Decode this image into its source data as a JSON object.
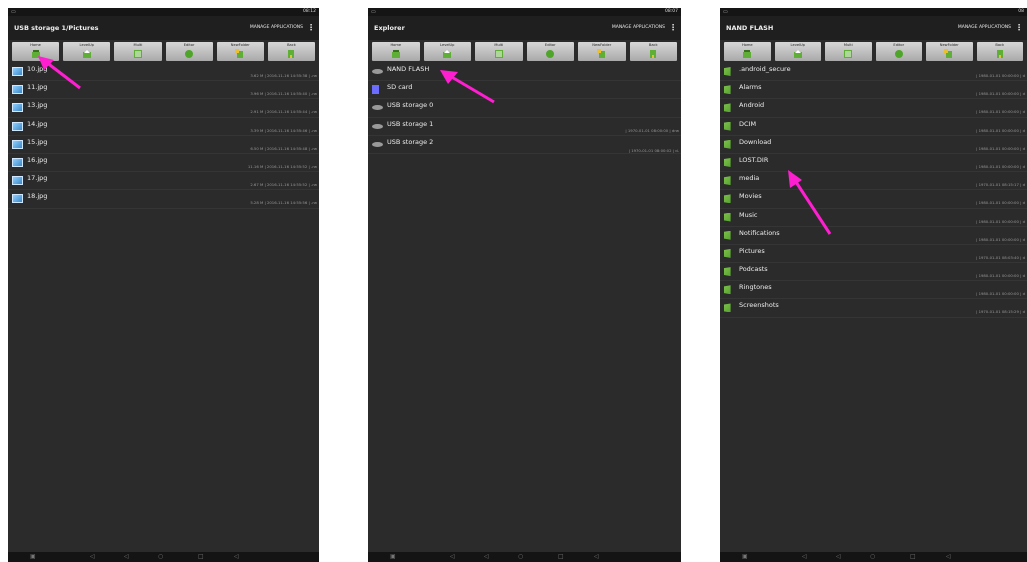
{
  "colors": {
    "accent_arrow": "#ff1fd0",
    "folder": "#5fae35",
    "background": "#2b2b2b"
  },
  "toolbar_labels": [
    "Home",
    "LevelUp",
    "Multi",
    "Editor",
    "NewFolder",
    "Back"
  ],
  "screen1": {
    "status_time": "08:12",
    "title": "USB storage 1/Pictures",
    "manage": "MANAGE APPLICATIONS",
    "overflow": "⋮",
    "files": [
      {
        "name": "10.jpg",
        "meta": "3.62 M | 2016-11-16 14:55:38 | -rw"
      },
      {
        "name": "11.jpg",
        "meta": "3.96 M | 2016-11-16 14:55:40 | -rw"
      },
      {
        "name": "13.jpg",
        "meta": "2.91 M | 2016-11-16 14:55:44 | -rw"
      },
      {
        "name": "14.jpg",
        "meta": "3.39 M | 2016-11-16 14:55:46 | -rw"
      },
      {
        "name": "15.jpg",
        "meta": "6.50 M | 2016-11-16 14:55:48 | -rw"
      },
      {
        "name": "16.jpg",
        "meta": "11.16 M | 2016-11-16 14:55:52 | -rw"
      },
      {
        "name": "17.jpg",
        "meta": "2.67 M | 2016-11-16 14:55:52 | -rw"
      },
      {
        "name": "18.jpg",
        "meta": "5.28 M | 2016-11-16 14:55:56 | -rw"
      }
    ]
  },
  "screen2": {
    "status_time": "08:07",
    "title": "Explorer",
    "manage": "MANAGE APPLICATIONS",
    "overflow": "⋮",
    "items": [
      {
        "name": "NAND FLASH",
        "meta": "",
        "icon": "drive-icon"
      },
      {
        "name": "SD card",
        "meta": "",
        "icon": "sd-card-icon"
      },
      {
        "name": "USB storage 0",
        "meta": "",
        "icon": "drive-icon"
      },
      {
        "name": "USB storage 1",
        "meta": "| 1970-01-01 08:00:00 | drw",
        "icon": "drive-icon"
      },
      {
        "name": "USB storage 2",
        "meta": "| 1970-01-01 08:00:02 | d-",
        "icon": "drive-icon"
      }
    ]
  },
  "screen3": {
    "status_time": "08",
    "title": "NAND FLASH",
    "manage": "MANAGE APPLICATIONS",
    "overflow": "⋮",
    "folders": [
      {
        "name": ".android_secure",
        "meta": "| 1980-01-01 00:00:00 | d"
      },
      {
        "name": "Alarms",
        "meta": "| 1980-01-01 00:00:00 | d"
      },
      {
        "name": "Android",
        "meta": "| 1980-01-01 00:00:00 | d"
      },
      {
        "name": "DCIM",
        "meta": "| 1980-01-01 00:00:00 | d"
      },
      {
        "name": "Download",
        "meta": "| 1980-01-01 00:00:00 | d"
      },
      {
        "name": "LOST.DIR",
        "meta": "| 1980-01-01 00:00:00 | d"
      },
      {
        "name": "media",
        "meta": "| 1970-01-01 08:15:17 | d"
      },
      {
        "name": "Movies",
        "meta": "| 1980-01-01 00:00:00 | d"
      },
      {
        "name": "Music",
        "meta": "| 1980-01-01 00:00:00 | d"
      },
      {
        "name": "Notifications",
        "meta": "| 1980-01-01 00:00:00 | d"
      },
      {
        "name": "Pictures",
        "meta": "| 1970-01-01 08:03:40 | d"
      },
      {
        "name": "Podcasts",
        "meta": "| 1980-01-01 00:00:00 | d"
      },
      {
        "name": "Ringtones",
        "meta": "| 1980-01-01 00:00:00 | d"
      },
      {
        "name": "Screenshots",
        "meta": "| 1970-01-01 08:15:29 | d"
      }
    ]
  }
}
